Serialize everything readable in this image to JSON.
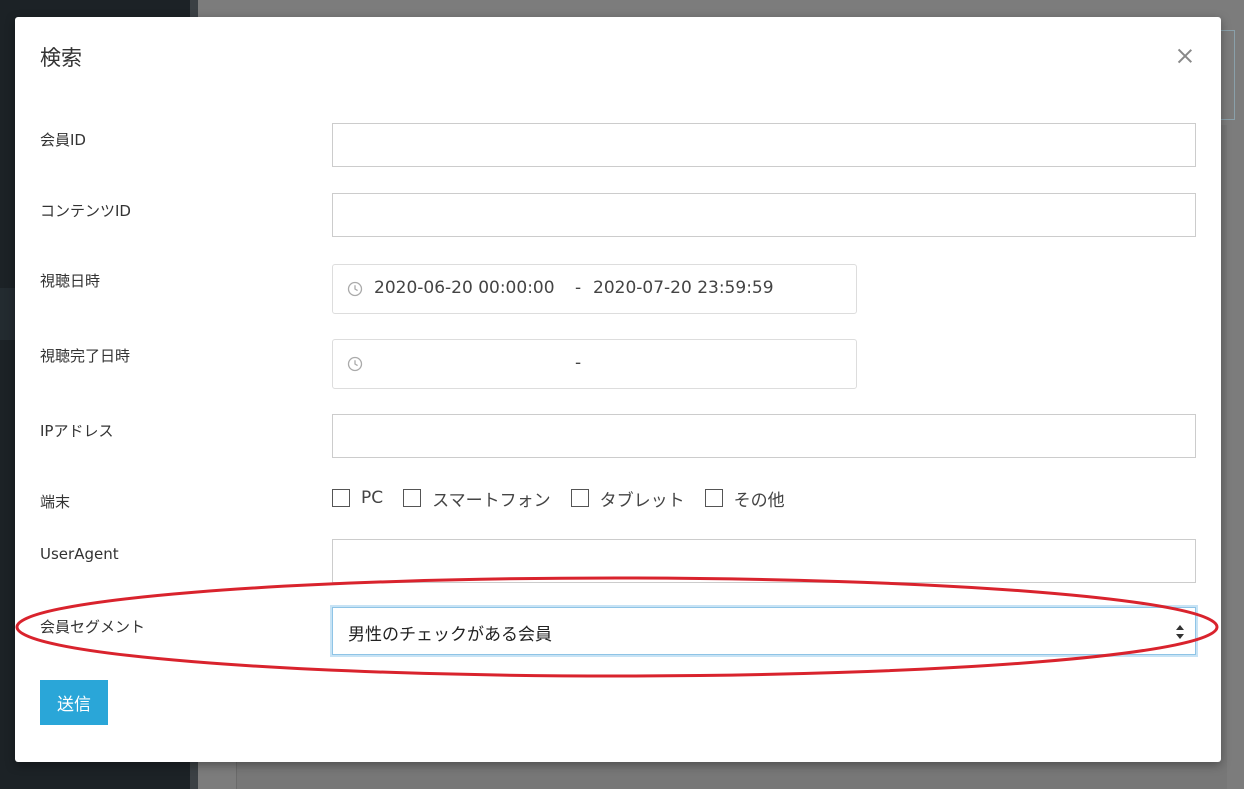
{
  "modal": {
    "title": "検索",
    "fields": {
      "member_id": {
        "label": "会員ID",
        "value": ""
      },
      "content_id": {
        "label": "コンテンツID",
        "value": ""
      },
      "view_datetime": {
        "label": "視聴日時",
        "start": "2020-06-20 00:00:00",
        "separator": "-",
        "end": "2020-07-20 23:59:59"
      },
      "view_complete_datetime": {
        "label": "視聴完了日時",
        "start": "",
        "separator": "-",
        "end": ""
      },
      "ip_address": {
        "label": "IPアドレス",
        "value": ""
      },
      "device": {
        "label": "端末",
        "options": [
          "PC",
          "スマートフォン",
          "タブレット",
          "その他"
        ]
      },
      "user_agent": {
        "label": "UserAgent",
        "value": ""
      },
      "member_segment": {
        "label": "会員セグメント",
        "selected": "男性のチェックがある会員"
      }
    },
    "submit_label": "送信"
  },
  "colors": {
    "submit_button": "#2aa6d8",
    "highlight_ellipse": "#d9232d",
    "overlay": "#7a7a7a"
  }
}
